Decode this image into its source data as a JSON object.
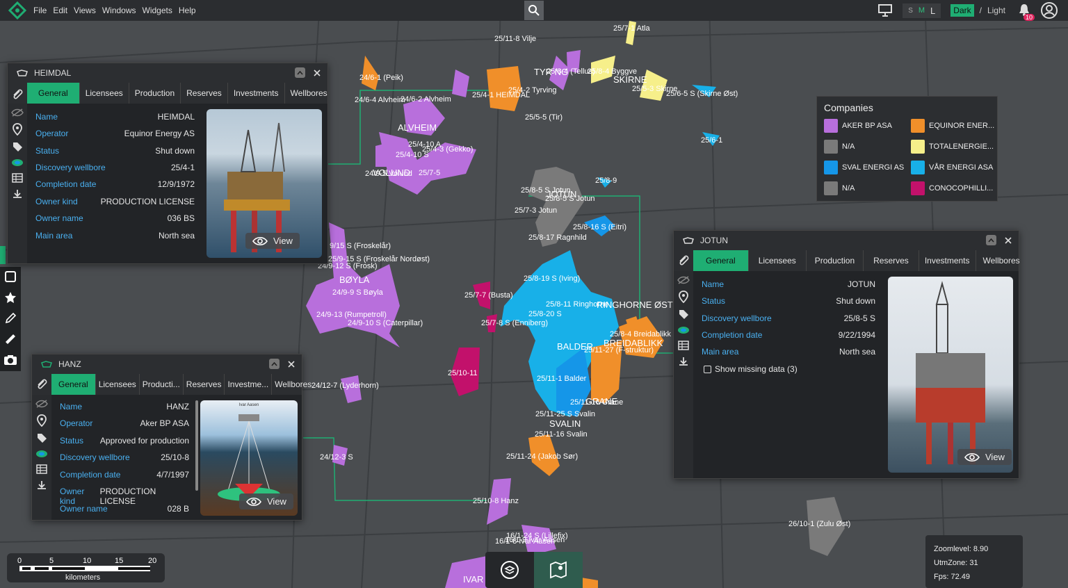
{
  "menu": [
    "File",
    "Edit",
    "Views",
    "Windows",
    "Widgets",
    "Help"
  ],
  "topbar": {
    "size_s": "S",
    "size_m": "M",
    "size_l": "L",
    "theme_dark": "Dark",
    "theme_sep": "/",
    "theme_light": "Light",
    "notif_count": "10"
  },
  "map_labels": [
    "25/7-1 Atla",
    "25/11-8 Vilje",
    "24/6-1 (Peik)",
    "TYR NG",
    "25/8-4 (Tellus)",
    "25/8-4 Byggve",
    "SKIRNE",
    "25/5-3 Skirne",
    "25/6-5 S (Skirne Øst)",
    "24/6-4 Alvheim",
    "24/6-2 Alvheim",
    "25/4-1 HEIMDAL",
    "25/4-2 Tyrving",
    "25/5-5 (Tir)",
    "25/6-1",
    "ALVHEIM",
    "25/4-10 A",
    "25/4-3 (Gekko)",
    "25/4-10 S",
    "VOLUND",
    "24/9-5 Volund",
    "25/7-5",
    "25/8-9",
    "25/8-5 S Jotun",
    "JOTUN",
    "25/8-5 S Jotun",
    "25/7-3 Jotun",
    "25/8-16 S (Eitri)",
    "25/8-17 Ragnhild",
    "25/8-11 Ringhorne",
    "25/8-19 S (Iving)",
    "BALDER",
    "25/8-20 S",
    "25/7-7 (Busta)",
    "RINGHORNE ØST",
    "25/7-8 S (Enniberg)",
    "BREIDABLIKK",
    "25/8-4 Breidablikk",
    "25/11-27 (F-struktur)",
    "9/15 S (Froskelår)",
    "25/9-15 S (Froskelår Nordøst)",
    "24/9-12 S (Frosk)",
    "BØYLA",
    "24/9-9 S Bøyla",
    "24/9-13 (Rumpetroll)",
    "24/9-10 S (Caterpillar)",
    "25/10-11",
    "25/11-1 Balder",
    "24/12-7 (Lyderhorn)",
    "25/11-16 Grane",
    "GRANE",
    "25/11-25 S Svalin",
    "SVALIN",
    "25/11-16 Svalin",
    "24/12-3 S",
    "25/11-24 (Jakob Sør)",
    "25/10-8 Hanz",
    "26/10-1 (Zulu Øst)",
    "16/1-24 S (Lillefix)",
    "16/1-8 Ivar Aasen",
    "16/1-9 Ivar Aasen",
    "IVAR AASEN"
  ],
  "heimdal": {
    "title": "HEIMDAL",
    "tabs": [
      "General",
      "Licensees",
      "Production",
      "Reserves",
      "Investments",
      "Wellbores"
    ],
    "rows": [
      [
        "Name",
        "HEIMDAL"
      ],
      [
        "Operator",
        "Equinor Energy AS"
      ],
      [
        "Status",
        "Shut down"
      ],
      [
        "Discovery wellbore",
        "25/4-1"
      ],
      [
        "Completion date",
        "12/9/1972"
      ],
      [
        "Owner kind",
        "PRODUCTION LICENSE"
      ],
      [
        "Owner name",
        "036 BS"
      ],
      [
        "Main area",
        "North sea"
      ]
    ],
    "view": "View"
  },
  "hanz": {
    "title": "HANZ",
    "tabs": [
      "General",
      "Licensees",
      "Producti...",
      "Reserves",
      "Investme...",
      "Wellbores"
    ],
    "rows": [
      [
        "Name",
        "HANZ"
      ],
      [
        "Operator",
        "Aker BP ASA"
      ],
      [
        "Status",
        "Approved for production"
      ],
      [
        "Discovery wellbore",
        "25/10-8"
      ],
      [
        "Completion date",
        "4/7/1997"
      ],
      [
        "Owner kind",
        "PRODUCTION LICENSE"
      ],
      [
        "Owner name",
        "028 B"
      ]
    ],
    "view": "View",
    "photo_caption": "Ivar Aasen"
  },
  "jotun": {
    "title": "JOTUN",
    "tabs": [
      "General",
      "Licensees",
      "Production",
      "Reserves",
      "Investments",
      "Wellbores"
    ],
    "rows": [
      [
        "Name",
        "JOTUN"
      ],
      [
        "Status",
        "Shut down"
      ],
      [
        "Discovery wellbore",
        "25/8-5 S"
      ],
      [
        "Completion date",
        "9/22/1994"
      ],
      [
        "Main area",
        "North sea"
      ]
    ],
    "missing": "Show missing data (3)",
    "view": "View"
  },
  "companies": {
    "title": "Companies",
    "items": [
      {
        "name": "AKER BP ASA",
        "color": "#b86fdc"
      },
      {
        "name": "EQUINOR ENER...",
        "color": "#f08f2a"
      },
      {
        "name": "N/A",
        "color": "#7a7a7a"
      },
      {
        "name": "TOTALENERGIE...",
        "color": "#f6ef8a"
      },
      {
        "name": "SVAL ENERGI AS",
        "color": "#1596e8"
      },
      {
        "name": "VÅR ENERGI ASA",
        "color": "#18b0e8"
      },
      {
        "name": "N/A",
        "color": "#7a7a7a"
      },
      {
        "name": "CONOCOPHILLI...",
        "color": "#c2116b"
      }
    ]
  },
  "scale": {
    "ticks": [
      "0",
      "5",
      "10",
      "15",
      "20"
    ],
    "unit": "kilometers"
  },
  "status": {
    "zoom": "Zoomlevel: 8.90",
    "utm": "UtmZone: 31",
    "fps": "Fps: 72.49"
  }
}
